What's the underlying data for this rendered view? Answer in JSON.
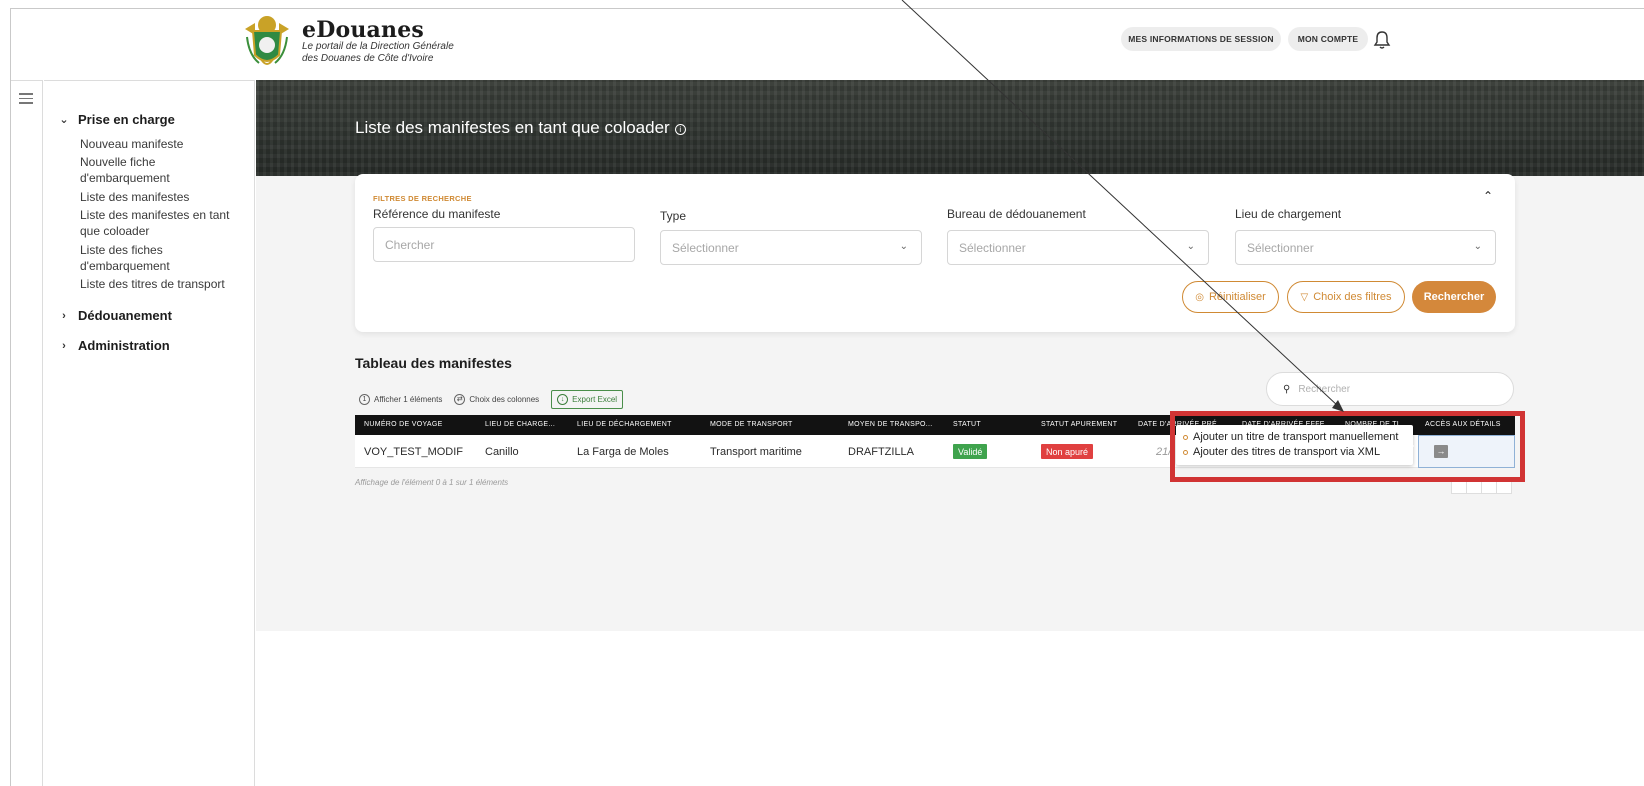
{
  "header": {
    "brand_title": "eDouanes",
    "brand_subtitle_line1": "Le portail de la Direction Générale",
    "brand_subtitle_line2": "des Douanes de Côte d'Ivoire",
    "session_button": "MES INFORMATIONS DE SESSION",
    "account_button": "MON COMPTE",
    "bell_icon": "bell-icon"
  },
  "sidebar": {
    "sections": [
      {
        "label": "Prise en charge",
        "expanded": true,
        "items": [
          "Nouveau manifeste",
          "Nouvelle fiche d'embarquement",
          "Liste des manifestes",
          "Liste des manifestes en tant que coloader",
          "Liste des fiches d'embarquement",
          "Liste des titres de transport"
        ]
      },
      {
        "label": "Dédouanement",
        "expanded": false
      },
      {
        "label": "Administration",
        "expanded": false
      }
    ]
  },
  "page": {
    "title": "Liste des manifestes en tant que coloader"
  },
  "filters": {
    "heading": "FILTRES DE RECHERCHE",
    "reference": {
      "label": "Référence du manifeste",
      "placeholder": "Chercher"
    },
    "type": {
      "label": "Type",
      "value": "Sélectionner"
    },
    "bureau": {
      "label": "Bureau de dédouanement",
      "value": "Sélectionner"
    },
    "lieu": {
      "label": "Lieu de chargement",
      "value": "Sélectionner"
    },
    "reset_button": "Réinitialiser",
    "choose_filters_button": "Choix des filtres",
    "search_button": "Rechercher"
  },
  "table": {
    "title": "Tableau des manifestes",
    "tools": {
      "show_count": "Afficher 1 éléments",
      "choose_columns": "Choix des colonnes",
      "export": "Export Excel"
    },
    "search_placeholder": "Rechercher",
    "columns": [
      "NUMÉRO DE VOYAGE",
      "LIEU DE CHARGE...",
      "LIEU DE DÉCHARGEMENT",
      "MODE DE TRANSPORT",
      "MOYEN DE TRANSPO...",
      "STATUT",
      "STATUT APUREMENT",
      "DATE D'ARRIVÉE PRÉ...",
      "DATE D'ARRIVÉE EFFE...",
      "NOMBRE DE TI...",
      "ACCÈS AUX DÉTAILS"
    ],
    "rows": [
      {
        "voyage": "VOY_TEST_MODIF",
        "lieu_chargement": "Canillo",
        "lieu_dechargement": "La Farga de Moles",
        "mode": "Transport maritime",
        "moyen": "DRAFTZILLA",
        "statut": "Validé",
        "statut_apurement": "Non apuré",
        "date_prevue": "21/"
      }
    ],
    "footer": "Affichage de l'élément 0 à 1 sur 1 éléments"
  },
  "popover": {
    "items": [
      "Ajouter un titre de transport manuellement",
      "Ajouter des titres de transport via XML"
    ]
  },
  "colors": {
    "accent": "#d4883b",
    "valid": "#3fa34d",
    "not_cleared": "#e04040",
    "highlight": "#d13434"
  }
}
